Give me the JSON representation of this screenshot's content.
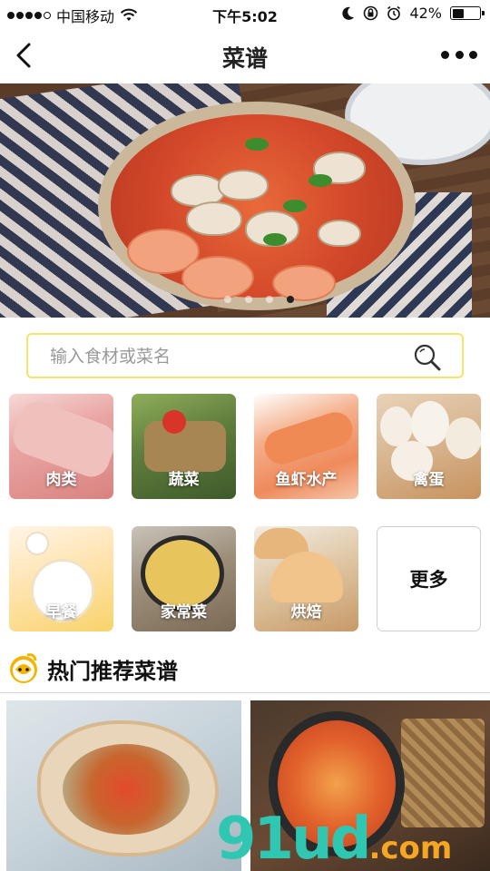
{
  "status_bar": {
    "carrier": "中国移动",
    "time": "下午5:02",
    "battery_text": "42%",
    "battery_level": 0.42
  },
  "nav": {
    "title": "菜谱",
    "back_icon": "chevron-left-icon",
    "more_icon": "more-icon"
  },
  "banner": {
    "slide_count": 4,
    "active_slide": 4
  },
  "search": {
    "placeholder": "输入食材或菜名",
    "value": "",
    "icon": "search-icon",
    "border_color": "#f5e36a"
  },
  "categories": [
    {
      "label": "肉类"
    },
    {
      "label": "蔬菜"
    },
    {
      "label": "鱼虾水产"
    },
    {
      "label": "禽蛋"
    },
    {
      "label": "早餐"
    },
    {
      "label": "家常菜"
    },
    {
      "label": "烘焙"
    },
    {
      "label": "更多"
    }
  ],
  "section": {
    "title": "热门推荐菜谱",
    "icon": "chef-hat-icon"
  },
  "watermark": {
    "part1": "91ud",
    "part2": ".com"
  },
  "colors": {
    "accent_yellow": "#f5e36a",
    "watermark_teal": "#2fc7b2",
    "watermark_orange": "#f5a623"
  }
}
